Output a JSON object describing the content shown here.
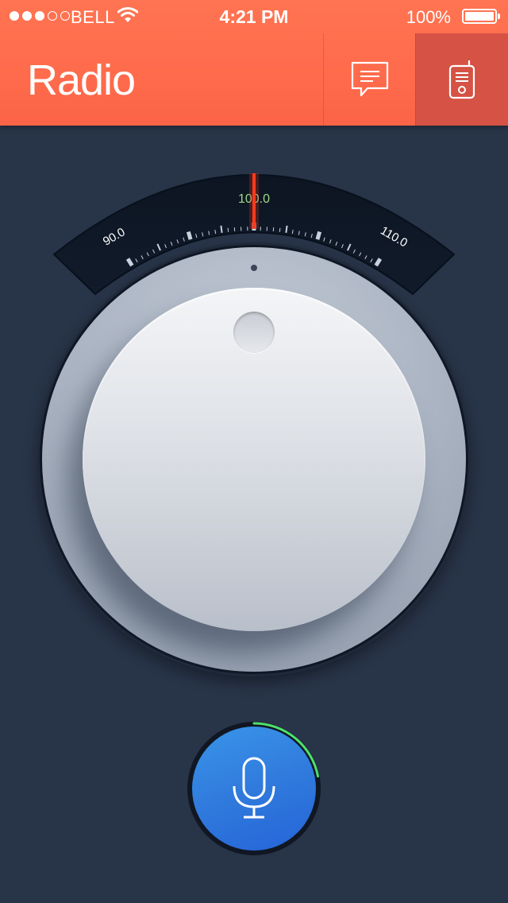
{
  "status_bar": {
    "signal_bars": 5,
    "signal_filled": 3,
    "carrier": "BELL",
    "time": "4:21 PM",
    "battery": "100%"
  },
  "navbar": {
    "title": "Radio",
    "buttons": [
      {
        "icon": "message-icon",
        "active": false
      },
      {
        "icon": "radio-device-icon",
        "active": true
      }
    ]
  },
  "tuner": {
    "current_frequency": "100.0",
    "scale_labels": [
      "90.0",
      "100.0",
      "110.0"
    ],
    "needle_color": "#ff3a1e"
  },
  "mic": {
    "icon": "microphone-icon",
    "level_fraction": 0.22,
    "level_color": "#4fe06a"
  },
  "colors": {
    "accent": "#ff6b4c",
    "background": "#283448",
    "mic_blue": "#2f78dc"
  }
}
